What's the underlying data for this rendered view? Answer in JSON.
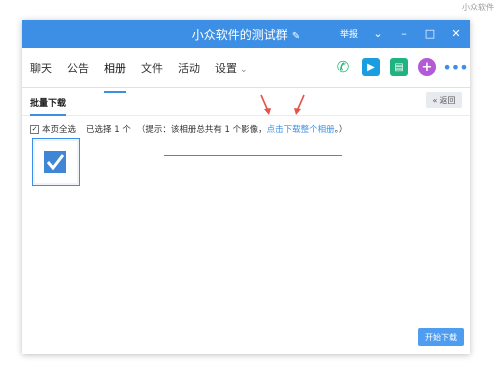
{
  "watermark": "小众软件",
  "titlebar": {
    "title": "小众软件的测试群",
    "report": "举报"
  },
  "tabs": [
    {
      "label": "聊天"
    },
    {
      "label": "公告"
    },
    {
      "label": "相册"
    },
    {
      "label": "文件"
    },
    {
      "label": "活动"
    },
    {
      "label": "设置"
    }
  ],
  "sub": {
    "title": "批量下载",
    "back": "返回"
  },
  "selection": {
    "select_all": "本页全选",
    "selected": "已选择 1 个",
    "hint_prefix": "（提示：该相册总共有 1 个影像，",
    "hint_link": "点击下载整个相册",
    "hint_suffix": "。）"
  },
  "start_button": "开始下载",
  "colors": {
    "accent": "#3d8fe6",
    "annotation": "#e4534a"
  }
}
